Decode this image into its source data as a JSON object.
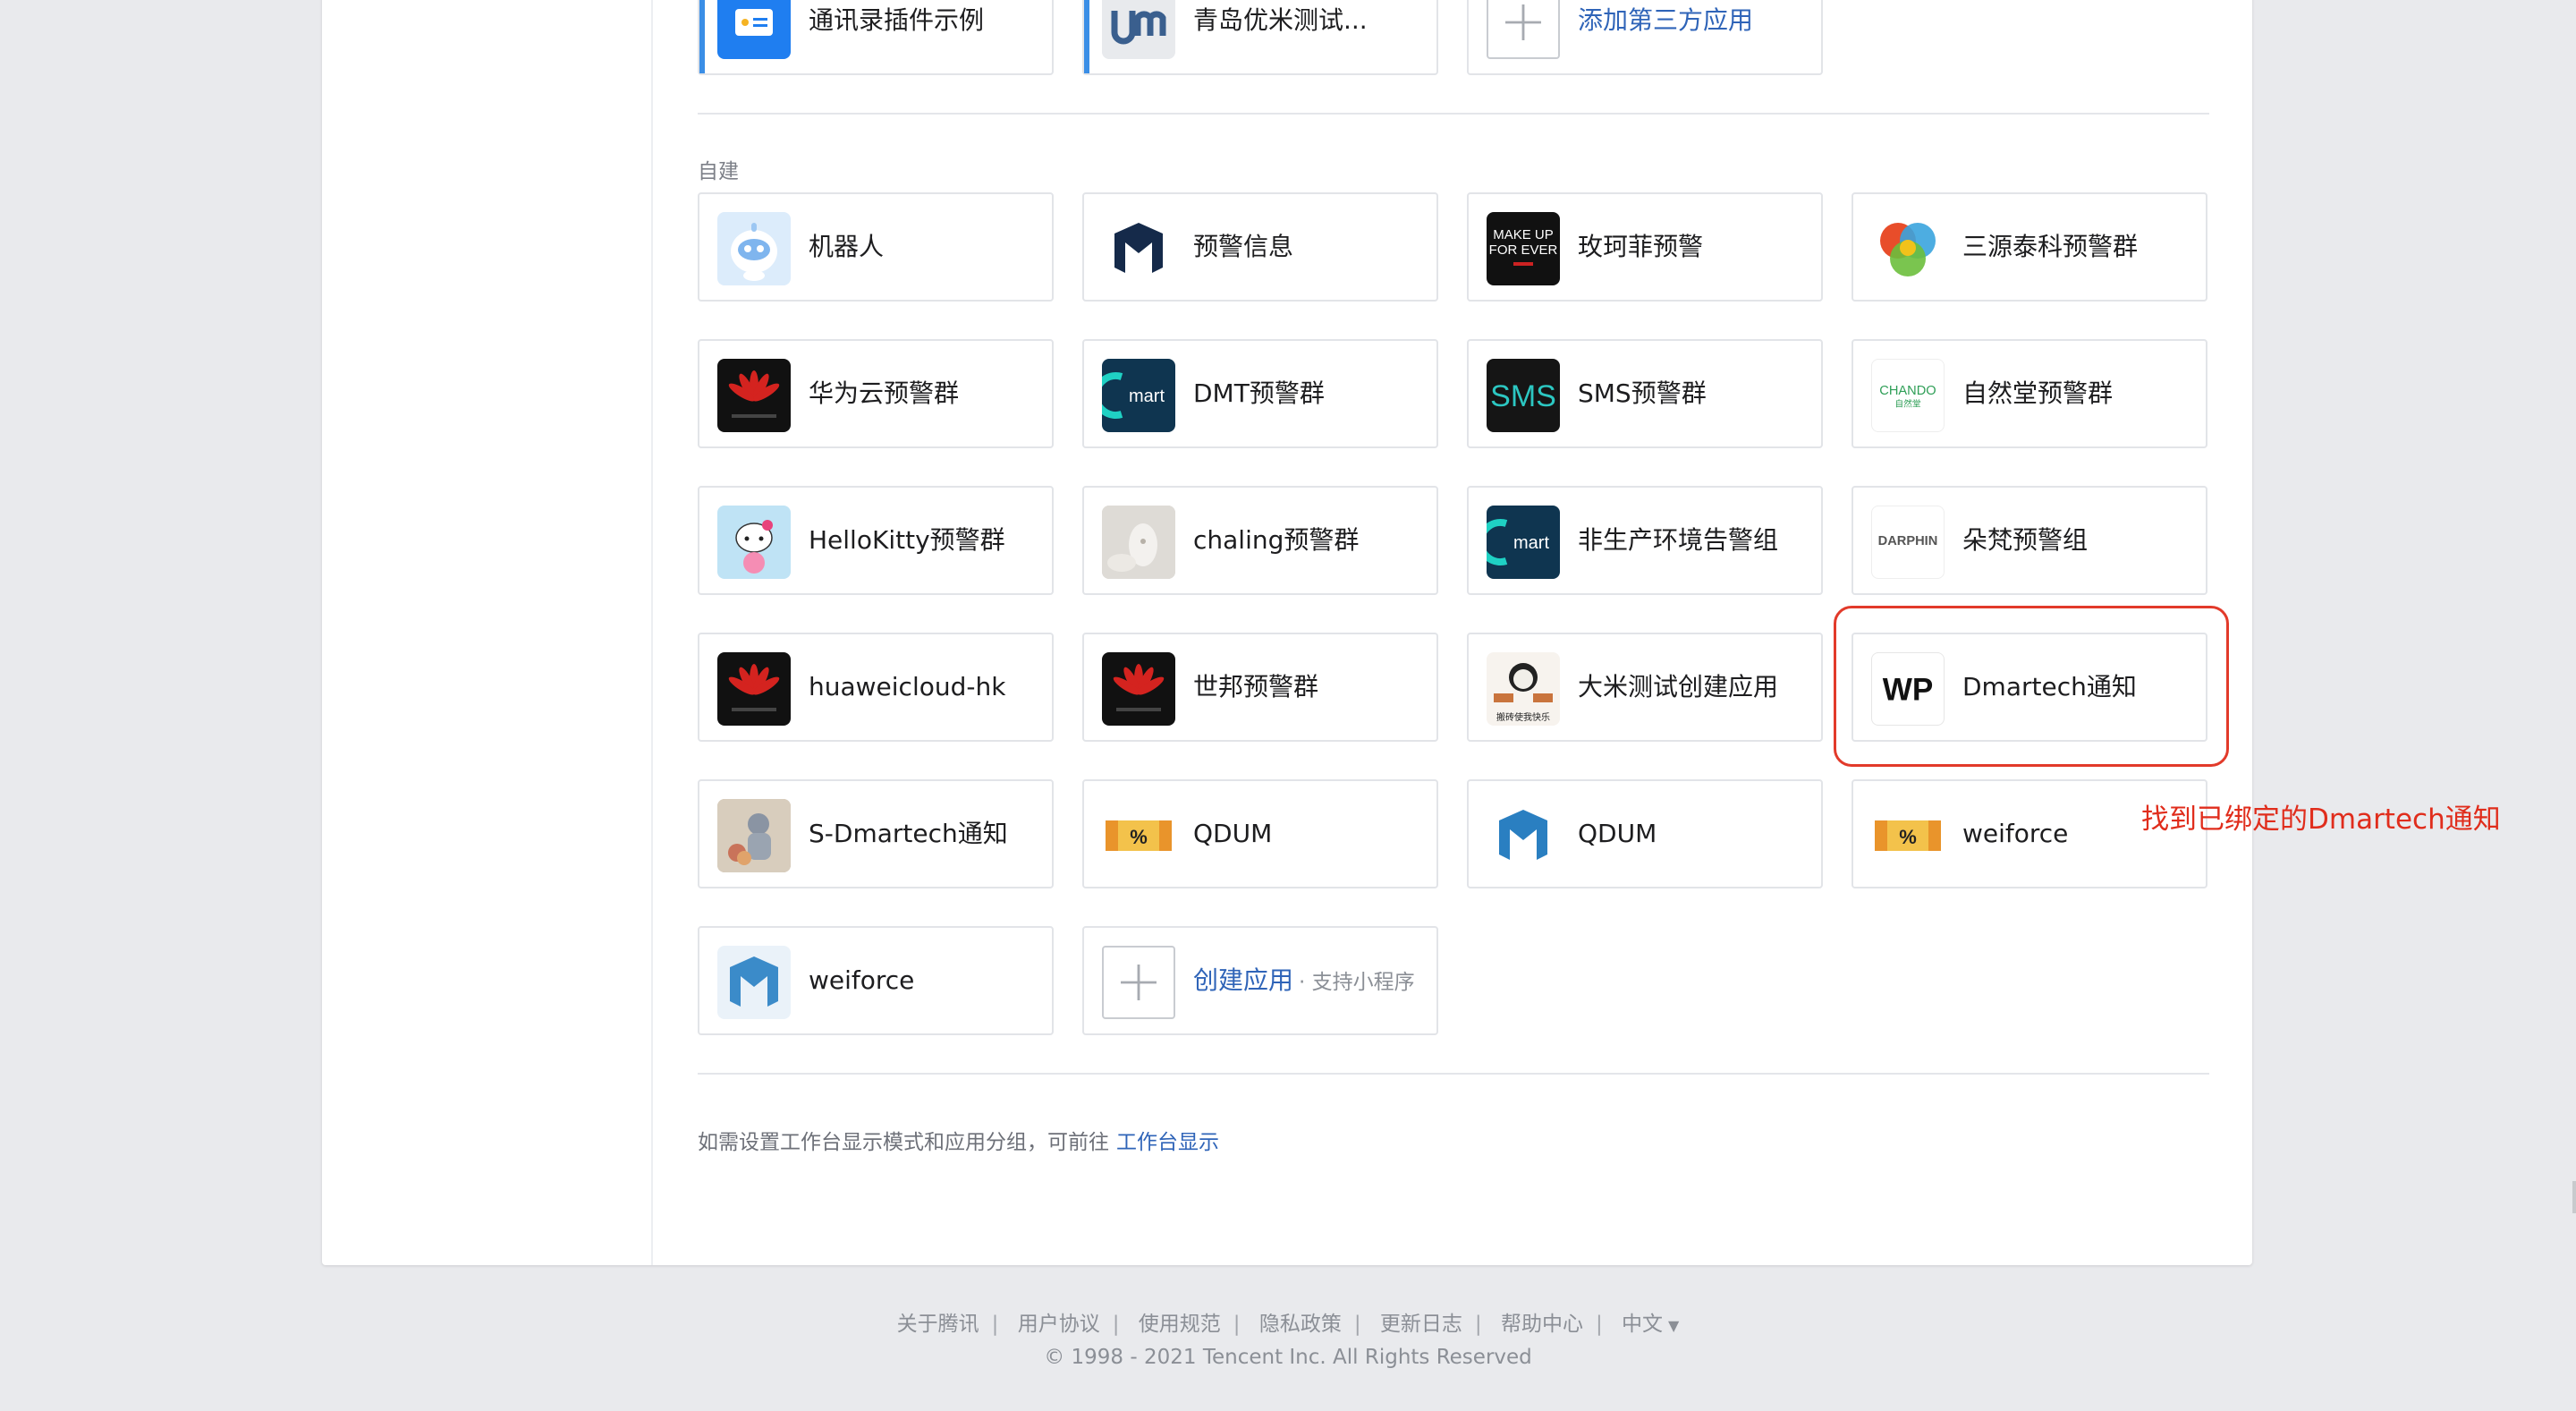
{
  "top_row": [
    {
      "label": "通讯录插件示例",
      "icon": "contacts-plugin-icon"
    },
    {
      "label": "青岛优米测试...",
      "icon": "um-logo-icon"
    },
    {
      "label": "添加第三方应用",
      "icon": "plus-icon"
    }
  ],
  "self_built_title": "自建",
  "apps": [
    {
      "label": "机器人",
      "icon": "robot-icon"
    },
    {
      "label": "预警信息",
      "icon": "m-logo-icon"
    },
    {
      "label": "玫珂菲预警",
      "icon": "makeup-forever-logo-icon",
      "icon_text": [
        "MAKE UP",
        "FOR EVER"
      ]
    },
    {
      "label": "三源泰科预警群",
      "icon": "sanyuan-logo-icon"
    },
    {
      "label": "华为云预警群",
      "icon": "huawei-logo-icon"
    },
    {
      "label": "DMT预警群",
      "icon": "dmart-logo-icon",
      "icon_text": "mart"
    },
    {
      "label": "SMS预警群",
      "icon": "sms-logo-icon",
      "icon_text": "SMS"
    },
    {
      "label": "自然堂预警群",
      "icon": "chando-logo-icon",
      "icon_text": [
        "CHANDO",
        "自然堂"
      ]
    },
    {
      "label": "HelloKitty预警群",
      "icon": "hello-kitty-icon"
    },
    {
      "label": "chaling预警群",
      "icon": "chaling-product-icon"
    },
    {
      "label": "非生产环境告警组",
      "icon": "dmart-logo-icon",
      "icon_text": "mart"
    },
    {
      "label": "朵梵预警组",
      "icon": "darphin-logo-icon",
      "icon_text": "DARPHIN"
    },
    {
      "label": "huaweicloud-hk",
      "icon": "huawei-logo-icon"
    },
    {
      "label": "世邦预警群",
      "icon": "huawei-logo-icon"
    },
    {
      "label": "大米测试创建应用",
      "icon": "meme-avatar-icon",
      "icon_text": "搬砖使我快乐"
    },
    {
      "label": "Dmartech通知",
      "icon": "wp-logo-icon",
      "icon_text": "WP"
    },
    {
      "label": "S-Dmartech通知",
      "icon": "photo-avatar-icon"
    },
    {
      "label": "QDUM",
      "icon": "coupon-icon",
      "icon_text": "%"
    },
    {
      "label": "QDUM",
      "icon": "m-logo-icon"
    },
    {
      "label": "weiforce",
      "icon": "coupon-icon",
      "icon_text": "%"
    },
    {
      "label": "weiforce",
      "icon": "m-logo-icon"
    }
  ],
  "create_app": {
    "label": "创建应用",
    "sub": "· 支持小程序"
  },
  "annotation": "找到已绑定的Dmartech通知",
  "hint": {
    "text": "如需设置工作台显示模式和应用分组，可前往",
    "link": "工作台显示"
  },
  "footer": {
    "links": [
      "关于腾讯",
      "用户协议",
      "使用规范",
      "隐私政策",
      "更新日志",
      "帮助中心"
    ],
    "language": "中文",
    "copyright": "© 1998 - 2021 Tencent Inc. All Rights Reserved"
  },
  "colors": {
    "accent": "#3a8ee6",
    "link": "#2f64b8",
    "annotation": "#e02d1c",
    "huawei_red": "#d4231f"
  }
}
